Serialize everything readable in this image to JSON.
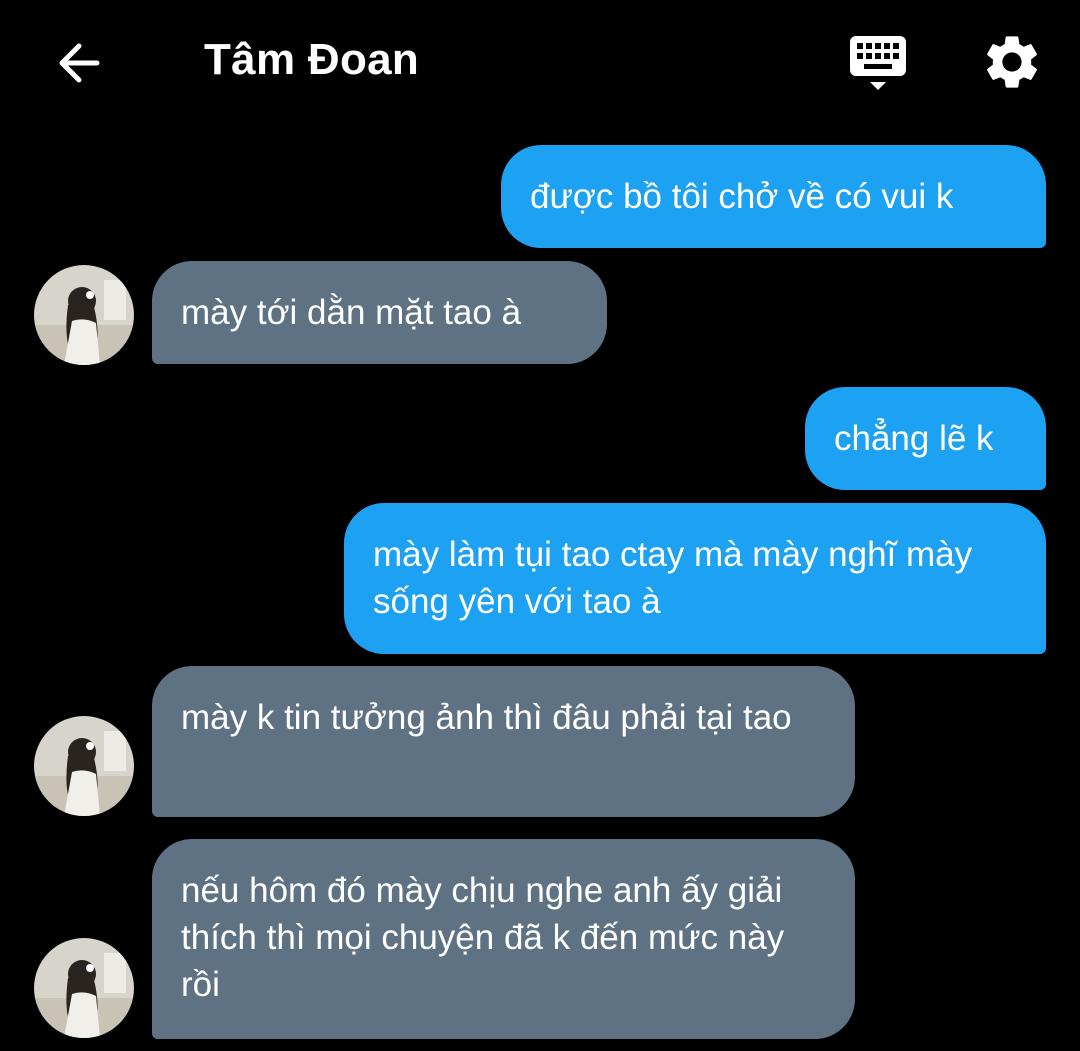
{
  "header": {
    "title": "Tâm Đoan",
    "back_icon": "arrow-left-icon",
    "keyboard_icon": "keyboard-icon",
    "settings_icon": "gear-icon"
  },
  "colors": {
    "background": "#000000",
    "sent_bubble": "#1da1f2",
    "received_bubble": "#5f7284",
    "text": "#ffffff"
  },
  "messages": [
    {
      "side": "sent",
      "text": "được bồ tôi chở về có vui k"
    },
    {
      "side": "received",
      "text": "mày tới dằn mặt tao à"
    },
    {
      "side": "sent",
      "text": "chẳng lẽ k"
    },
    {
      "side": "sent",
      "text": "mày làm tụi tao ctay mà mày nghĩ mày sống yên với tao à"
    },
    {
      "side": "received",
      "text": "mày k tin tưởng ảnh thì đâu phải tại tao"
    },
    {
      "side": "received",
      "text": "nếu hôm đó mày chịu nghe anh ấy giải thích thì mọi chuyện đã k đến mức này rồi"
    }
  ]
}
